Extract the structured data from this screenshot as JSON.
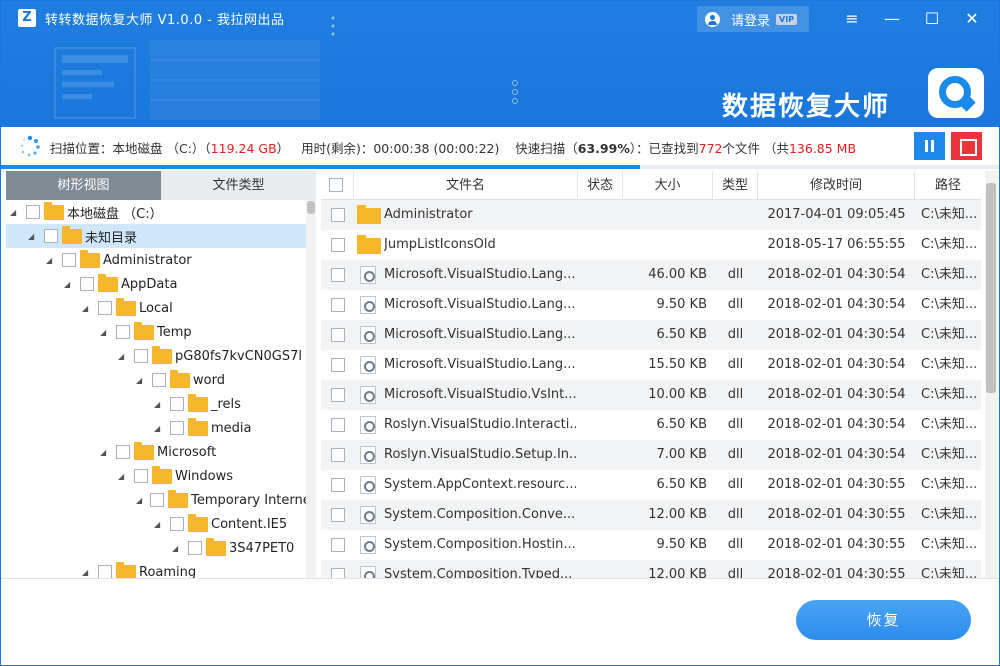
{
  "window": {
    "app_icon_letter": "Z",
    "title": "转转数据恢复大师 V1.0.0 - 我拉网出品",
    "login_label": "请登录",
    "vip_badge": "VIP",
    "brand": "数据恢复大师",
    "controls": {
      "menu": "≡",
      "minimize": "—",
      "maximize": "☐",
      "close": "✕"
    }
  },
  "scan": {
    "location_label": "扫描位置：本地磁盘 （C:）（",
    "location_size": "119.24 GB",
    "location_close": "）",
    "time_label": "用时(剩余)：00:00:38 (00:00:22)",
    "mode_label": "快速扫描（",
    "percent": "63.99%",
    "found_prefix": "）：已查找到",
    "found_count": "772",
    "found_mid": "个文件 （共",
    "found_size": "136.85 MB",
    "progress_fraction": 0.6399
  },
  "left_tabs": {
    "tree_view": "树形视图",
    "file_type": "文件类型"
  },
  "tree": [
    {
      "label": "本地磁盘 （C:）",
      "depth": 0,
      "selected": false
    },
    {
      "label": "未知目录",
      "depth": 1,
      "selected": true
    },
    {
      "label": "Administrator",
      "depth": 2,
      "selected": false
    },
    {
      "label": "AppData",
      "depth": 3,
      "selected": false
    },
    {
      "label": "Local",
      "depth": 4,
      "selected": false
    },
    {
      "label": "Temp",
      "depth": 5,
      "selected": false
    },
    {
      "label": "pG80fs7kvCN0GS7l",
      "depth": 6,
      "selected": false
    },
    {
      "label": "word",
      "depth": 7,
      "selected": false
    },
    {
      "label": "_rels",
      "depth": 8,
      "selected": false
    },
    {
      "label": "media",
      "depth": 8,
      "selected": false
    },
    {
      "label": "Microsoft",
      "depth": 5,
      "selected": false
    },
    {
      "label": "Windows",
      "depth": 6,
      "selected": false
    },
    {
      "label": "Temporary Internet Files",
      "depth": 7,
      "selected": false
    },
    {
      "label": "Content.IE5",
      "depth": 8,
      "selected": false
    },
    {
      "label": "3S47PET0",
      "depth": 9,
      "selected": false
    },
    {
      "label": "Roaming",
      "depth": 4,
      "selected": false
    }
  ],
  "table": {
    "headers": {
      "name": "文件名",
      "status": "状态",
      "size": "大小",
      "type": "类型",
      "modified": "修改时间",
      "path": "路径"
    },
    "rows": [
      {
        "icon": "folder",
        "name": "Administrator",
        "status": "",
        "size": "",
        "type": "",
        "modified": "2017-04-01 09:05:45",
        "path": "C:\\未知..."
      },
      {
        "icon": "folder",
        "name": "JumpListIconsOld",
        "status": "",
        "size": "",
        "type": "",
        "modified": "2018-05-17 06:55:55",
        "path": "C:\\未知..."
      },
      {
        "icon": "dll",
        "name": "Microsoft.VisualStudio.Lang...",
        "status": "",
        "size": "46.00 KB",
        "type": "dll",
        "modified": "2018-02-01 04:30:54",
        "path": "C:\\未知..."
      },
      {
        "icon": "dll",
        "name": "Microsoft.VisualStudio.Lang...",
        "status": "",
        "size": "9.50 KB",
        "type": "dll",
        "modified": "2018-02-01 04:30:54",
        "path": "C:\\未知..."
      },
      {
        "icon": "dll",
        "name": "Microsoft.VisualStudio.Lang...",
        "status": "",
        "size": "6.50 KB",
        "type": "dll",
        "modified": "2018-02-01 04:30:54",
        "path": "C:\\未知..."
      },
      {
        "icon": "dll",
        "name": "Microsoft.VisualStudio.Lang...",
        "status": "",
        "size": "15.50 KB",
        "type": "dll",
        "modified": "2018-02-01 04:30:54",
        "path": "C:\\未知..."
      },
      {
        "icon": "dll",
        "name": "Microsoft.VisualStudio.VsInt...",
        "status": "",
        "size": "10.00 KB",
        "type": "dll",
        "modified": "2018-02-01 04:30:54",
        "path": "C:\\未知..."
      },
      {
        "icon": "dll",
        "name": "Roslyn.VisualStudio.Interacti...",
        "status": "",
        "size": "6.50 KB",
        "type": "dll",
        "modified": "2018-02-01 04:30:54",
        "path": "C:\\未知..."
      },
      {
        "icon": "dll",
        "name": "Roslyn.VisualStudio.Setup.In...",
        "status": "",
        "size": "7.00 KB",
        "type": "dll",
        "modified": "2018-02-01 04:30:54",
        "path": "C:\\未知..."
      },
      {
        "icon": "dll",
        "name": "System.AppContext.resourc...",
        "status": "",
        "size": "6.50 KB",
        "type": "dll",
        "modified": "2018-02-01 04:30:55",
        "path": "C:\\未知..."
      },
      {
        "icon": "dll",
        "name": "System.Composition.Conve...",
        "status": "",
        "size": "12.00 KB",
        "type": "dll",
        "modified": "2018-02-01 04:30:55",
        "path": "C:\\未知..."
      },
      {
        "icon": "dll",
        "name": "System.Composition.Hostin...",
        "status": "",
        "size": "9.50 KB",
        "type": "dll",
        "modified": "2018-02-01 04:30:55",
        "path": "C:\\未知..."
      },
      {
        "icon": "dll",
        "name": "System.Composition.Typed...",
        "status": "",
        "size": "12.00 KB",
        "type": "dll",
        "modified": "2018-02-01 04:30:55",
        "path": "C:\\未知..."
      }
    ]
  },
  "footer": {
    "recover_label": "恢复"
  },
  "colors": {
    "primary": "#1a76db",
    "accent_red": "#e02020",
    "stop_red": "#e8343a",
    "folder": "#f7b52b",
    "selected_row": "#cfe6fb"
  }
}
